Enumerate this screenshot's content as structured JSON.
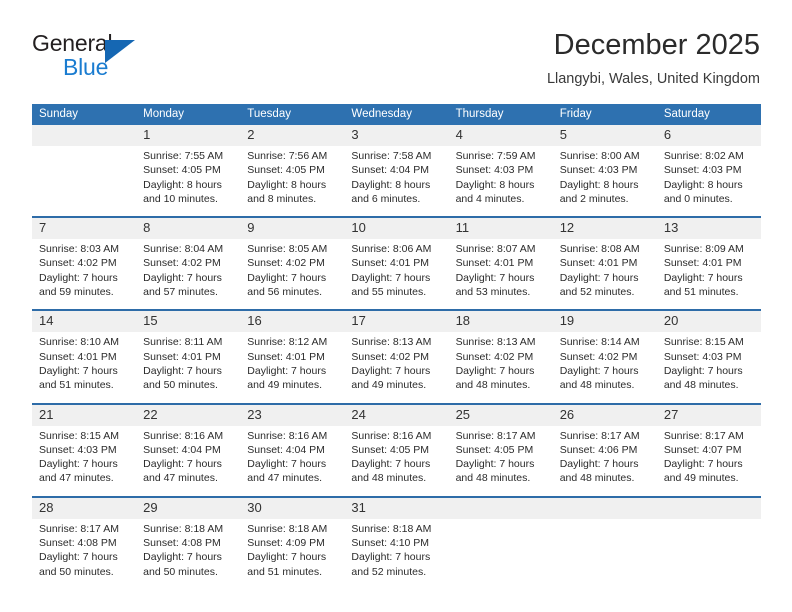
{
  "brand": {
    "name_top": "General",
    "name_bottom": "Blue",
    "triangle_color": "#1567b3",
    "blue_color": "#1a7cd0"
  },
  "header": {
    "title": "December 2025",
    "subtitle": "Llangybi, Wales, United Kingdom"
  },
  "colors": {
    "header_blue": "#2e71b0",
    "week_divider": "#2e6ca8",
    "daynum_bg": "#f0f0f0",
    "cell_bg": "#ffffff"
  },
  "calendar": {
    "weekday_headers": [
      "Sunday",
      "Monday",
      "Tuesday",
      "Wednesday",
      "Thursday",
      "Friday",
      "Saturday"
    ],
    "weeks": [
      [
        {
          "day": "",
          "sunrise": "",
          "sunset": "",
          "daylight_1": "",
          "daylight_2": ""
        },
        {
          "day": "1",
          "sunrise": "Sunrise: 7:55 AM",
          "sunset": "Sunset: 4:05 PM",
          "daylight_1": "Daylight: 8 hours",
          "daylight_2": "and 10 minutes."
        },
        {
          "day": "2",
          "sunrise": "Sunrise: 7:56 AM",
          "sunset": "Sunset: 4:05 PM",
          "daylight_1": "Daylight: 8 hours",
          "daylight_2": "and 8 minutes."
        },
        {
          "day": "3",
          "sunrise": "Sunrise: 7:58 AM",
          "sunset": "Sunset: 4:04 PM",
          "daylight_1": "Daylight: 8 hours",
          "daylight_2": "and 6 minutes."
        },
        {
          "day": "4",
          "sunrise": "Sunrise: 7:59 AM",
          "sunset": "Sunset: 4:03 PM",
          "daylight_1": "Daylight: 8 hours",
          "daylight_2": "and 4 minutes."
        },
        {
          "day": "5",
          "sunrise": "Sunrise: 8:00 AM",
          "sunset": "Sunset: 4:03 PM",
          "daylight_1": "Daylight: 8 hours",
          "daylight_2": "and 2 minutes."
        },
        {
          "day": "6",
          "sunrise": "Sunrise: 8:02 AM",
          "sunset": "Sunset: 4:03 PM",
          "daylight_1": "Daylight: 8 hours",
          "daylight_2": "and 0 minutes."
        }
      ],
      [
        {
          "day": "7",
          "sunrise": "Sunrise: 8:03 AM",
          "sunset": "Sunset: 4:02 PM",
          "daylight_1": "Daylight: 7 hours",
          "daylight_2": "and 59 minutes."
        },
        {
          "day": "8",
          "sunrise": "Sunrise: 8:04 AM",
          "sunset": "Sunset: 4:02 PM",
          "daylight_1": "Daylight: 7 hours",
          "daylight_2": "and 57 minutes."
        },
        {
          "day": "9",
          "sunrise": "Sunrise: 8:05 AM",
          "sunset": "Sunset: 4:02 PM",
          "daylight_1": "Daylight: 7 hours",
          "daylight_2": "and 56 minutes."
        },
        {
          "day": "10",
          "sunrise": "Sunrise: 8:06 AM",
          "sunset": "Sunset: 4:01 PM",
          "daylight_1": "Daylight: 7 hours",
          "daylight_2": "and 55 minutes."
        },
        {
          "day": "11",
          "sunrise": "Sunrise: 8:07 AM",
          "sunset": "Sunset: 4:01 PM",
          "daylight_1": "Daylight: 7 hours",
          "daylight_2": "and 53 minutes."
        },
        {
          "day": "12",
          "sunrise": "Sunrise: 8:08 AM",
          "sunset": "Sunset: 4:01 PM",
          "daylight_1": "Daylight: 7 hours",
          "daylight_2": "and 52 minutes."
        },
        {
          "day": "13",
          "sunrise": "Sunrise: 8:09 AM",
          "sunset": "Sunset: 4:01 PM",
          "daylight_1": "Daylight: 7 hours",
          "daylight_2": "and 51 minutes."
        }
      ],
      [
        {
          "day": "14",
          "sunrise": "Sunrise: 8:10 AM",
          "sunset": "Sunset: 4:01 PM",
          "daylight_1": "Daylight: 7 hours",
          "daylight_2": "and 51 minutes."
        },
        {
          "day": "15",
          "sunrise": "Sunrise: 8:11 AM",
          "sunset": "Sunset: 4:01 PM",
          "daylight_1": "Daylight: 7 hours",
          "daylight_2": "and 50 minutes."
        },
        {
          "day": "16",
          "sunrise": "Sunrise: 8:12 AM",
          "sunset": "Sunset: 4:01 PM",
          "daylight_1": "Daylight: 7 hours",
          "daylight_2": "and 49 minutes."
        },
        {
          "day": "17",
          "sunrise": "Sunrise: 8:13 AM",
          "sunset": "Sunset: 4:02 PM",
          "daylight_1": "Daylight: 7 hours",
          "daylight_2": "and 49 minutes."
        },
        {
          "day": "18",
          "sunrise": "Sunrise: 8:13 AM",
          "sunset": "Sunset: 4:02 PM",
          "daylight_1": "Daylight: 7 hours",
          "daylight_2": "and 48 minutes."
        },
        {
          "day": "19",
          "sunrise": "Sunrise: 8:14 AM",
          "sunset": "Sunset: 4:02 PM",
          "daylight_1": "Daylight: 7 hours",
          "daylight_2": "and 48 minutes."
        },
        {
          "day": "20",
          "sunrise": "Sunrise: 8:15 AM",
          "sunset": "Sunset: 4:03 PM",
          "daylight_1": "Daylight: 7 hours",
          "daylight_2": "and 48 minutes."
        }
      ],
      [
        {
          "day": "21",
          "sunrise": "Sunrise: 8:15 AM",
          "sunset": "Sunset: 4:03 PM",
          "daylight_1": "Daylight: 7 hours",
          "daylight_2": "and 47 minutes."
        },
        {
          "day": "22",
          "sunrise": "Sunrise: 8:16 AM",
          "sunset": "Sunset: 4:04 PM",
          "daylight_1": "Daylight: 7 hours",
          "daylight_2": "and 47 minutes."
        },
        {
          "day": "23",
          "sunrise": "Sunrise: 8:16 AM",
          "sunset": "Sunset: 4:04 PM",
          "daylight_1": "Daylight: 7 hours",
          "daylight_2": "and 47 minutes."
        },
        {
          "day": "24",
          "sunrise": "Sunrise: 8:16 AM",
          "sunset": "Sunset: 4:05 PM",
          "daylight_1": "Daylight: 7 hours",
          "daylight_2": "and 48 minutes."
        },
        {
          "day": "25",
          "sunrise": "Sunrise: 8:17 AM",
          "sunset": "Sunset: 4:05 PM",
          "daylight_1": "Daylight: 7 hours",
          "daylight_2": "and 48 minutes."
        },
        {
          "day": "26",
          "sunrise": "Sunrise: 8:17 AM",
          "sunset": "Sunset: 4:06 PM",
          "daylight_1": "Daylight: 7 hours",
          "daylight_2": "and 48 minutes."
        },
        {
          "day": "27",
          "sunrise": "Sunrise: 8:17 AM",
          "sunset": "Sunset: 4:07 PM",
          "daylight_1": "Daylight: 7 hours",
          "daylight_2": "and 49 minutes."
        }
      ],
      [
        {
          "day": "28",
          "sunrise": "Sunrise: 8:17 AM",
          "sunset": "Sunset: 4:08 PM",
          "daylight_1": "Daylight: 7 hours",
          "daylight_2": "and 50 minutes."
        },
        {
          "day": "29",
          "sunrise": "Sunrise: 8:18 AM",
          "sunset": "Sunset: 4:08 PM",
          "daylight_1": "Daylight: 7 hours",
          "daylight_2": "and 50 minutes."
        },
        {
          "day": "30",
          "sunrise": "Sunrise: 8:18 AM",
          "sunset": "Sunset: 4:09 PM",
          "daylight_1": "Daylight: 7 hours",
          "daylight_2": "and 51 minutes."
        },
        {
          "day": "31",
          "sunrise": "Sunrise: 8:18 AM",
          "sunset": "Sunset: 4:10 PM",
          "daylight_1": "Daylight: 7 hours",
          "daylight_2": "and 52 minutes."
        },
        {
          "day": "",
          "sunrise": "",
          "sunset": "",
          "daylight_1": "",
          "daylight_2": ""
        },
        {
          "day": "",
          "sunrise": "",
          "sunset": "",
          "daylight_1": "",
          "daylight_2": ""
        },
        {
          "day": "",
          "sunrise": "",
          "sunset": "",
          "daylight_1": "",
          "daylight_2": ""
        }
      ]
    ]
  }
}
